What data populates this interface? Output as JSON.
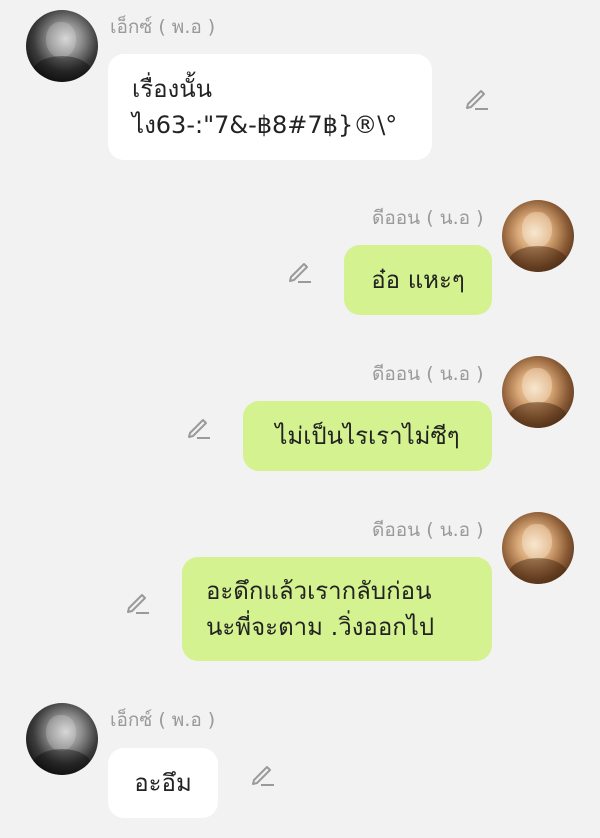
{
  "messages": [
    {
      "sender": "เอ็กซ์ ( พ.อ )",
      "lines": [
        "เรื่องนั้น",
        "ไง63-:\"7&-฿8#7฿}®\\°"
      ],
      "side": "left"
    },
    {
      "sender": "ดีออน ( น.อ )",
      "lines": [
        "อ๋อ แหะๆ"
      ],
      "side": "right"
    },
    {
      "sender": "ดีออน ( น.อ )",
      "lines": [
        "ไม่เป็นไรเราไม่ซีๆ"
      ],
      "side": "right"
    },
    {
      "sender": "ดีออน ( น.อ )",
      "lines": [
        "อะดึกแล้วเรากลับก่อน",
        "นะพี่จะตาม .วิ่งออกไป"
      ],
      "side": "right"
    },
    {
      "sender": "เอ็กซ์ ( พ.อ )",
      "lines": [
        "อะอึม"
      ],
      "side": "left"
    }
  ],
  "icons": {
    "avatar_left": "avatar-photo-dark",
    "avatar_right": "avatar-photo-warm",
    "edit": "pencil-icon"
  },
  "colors": {
    "background": "#f2f2f2",
    "bubble_left": "#ffffff",
    "bubble_right": "#d4f28f",
    "sender_text": "#9a9a9a"
  }
}
